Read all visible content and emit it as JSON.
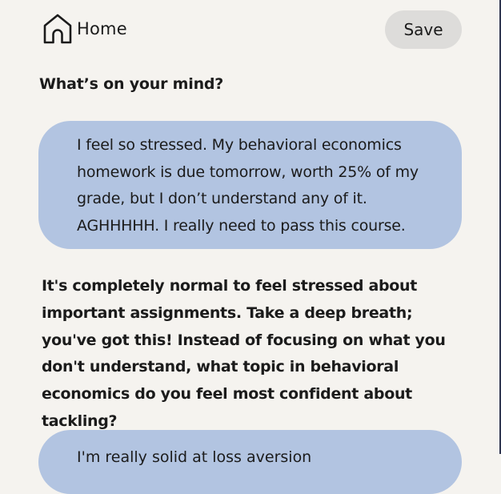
{
  "header": {
    "home_label": "Home",
    "home_icon": "home-icon",
    "save_label": "Save"
  },
  "prompt": {
    "title": "What’s on your mind?"
  },
  "conversation": {
    "user_message": "I feel so stressed. My behavioral economics homework is due tomorrow, worth 25% of my grade, but I don’t understand any of it. AGHHHHH. I really need to pass this course.",
    "assistant_reply": "It's completely normal to feel stressed about important assignments. Take a deep breath; you've got this! Instead of focusing on what you don't understand, what topic in behavioral economics do you feel most confident about tackling?",
    "next_user_message_partial": "I'm really solid at loss aversion"
  },
  "colors": {
    "background": "#f5f3ef",
    "bubble": "#b2c4e1",
    "save_button": "#dddcda",
    "text": "#1b1b1b"
  }
}
